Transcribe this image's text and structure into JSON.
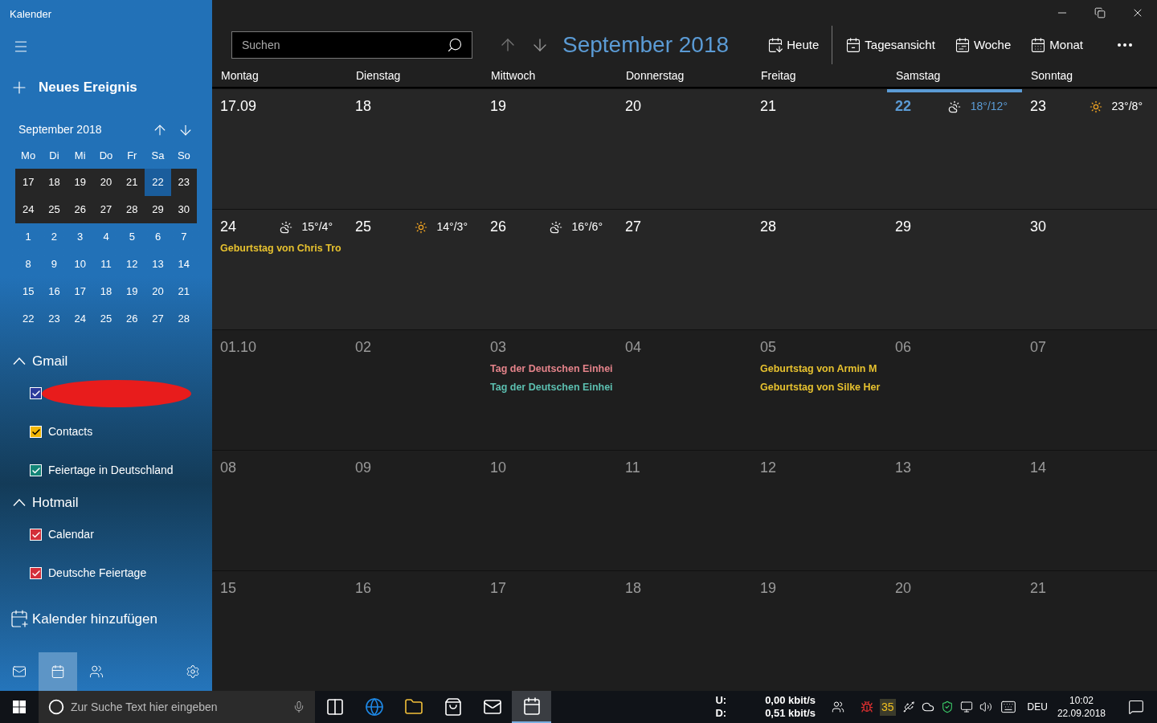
{
  "app_title": "Kalender",
  "new_event": "Neues Ereignis",
  "mini_calendar": {
    "title": "September 2018",
    "weekdays": [
      "Mo",
      "Di",
      "Mi",
      "Do",
      "Fr",
      "Sa",
      "So"
    ],
    "weeks": [
      {
        "in_view": true,
        "days": [
          {
            "label": "17",
            "selected": false
          },
          {
            "label": "18",
            "selected": false
          },
          {
            "label": "19",
            "selected": false
          },
          {
            "label": "20",
            "selected": false
          },
          {
            "label": "21",
            "selected": false
          },
          {
            "label": "22",
            "selected": true
          },
          {
            "label": "23",
            "selected": false
          }
        ]
      },
      {
        "in_view": true,
        "days": [
          {
            "label": "24",
            "selected": false
          },
          {
            "label": "25",
            "selected": false
          },
          {
            "label": "26",
            "selected": false
          },
          {
            "label": "27",
            "selected": false
          },
          {
            "label": "28",
            "selected": false
          },
          {
            "label": "29",
            "selected": false
          },
          {
            "label": "30",
            "selected": false
          }
        ]
      },
      {
        "in_view": false,
        "days": [
          {
            "label": "1",
            "selected": false
          },
          {
            "label": "2",
            "selected": false
          },
          {
            "label": "3",
            "selected": false
          },
          {
            "label": "4",
            "selected": false
          },
          {
            "label": "5",
            "selected": false
          },
          {
            "label": "6",
            "selected": false
          },
          {
            "label": "7",
            "selected": false
          }
        ]
      },
      {
        "in_view": false,
        "days": [
          {
            "label": "8",
            "selected": false
          },
          {
            "label": "9",
            "selected": false
          },
          {
            "label": "10",
            "selected": false
          },
          {
            "label": "11",
            "selected": false
          },
          {
            "label": "12",
            "selected": false
          },
          {
            "label": "13",
            "selected": false
          },
          {
            "label": "14",
            "selected": false
          }
        ]
      },
      {
        "in_view": false,
        "days": [
          {
            "label": "15",
            "selected": false
          },
          {
            "label": "16",
            "selected": false
          },
          {
            "label": "17",
            "selected": false
          },
          {
            "label": "18",
            "selected": false
          },
          {
            "label": "19",
            "selected": false
          },
          {
            "label": "20",
            "selected": false
          },
          {
            "label": "21",
            "selected": false
          }
        ]
      },
      {
        "in_view": false,
        "days": [
          {
            "label": "22",
            "selected": false
          },
          {
            "label": "23",
            "selected": false
          },
          {
            "label": "24",
            "selected": false
          },
          {
            "label": "25",
            "selected": false
          },
          {
            "label": "26",
            "selected": false
          },
          {
            "label": "27",
            "selected": false
          },
          {
            "label": "28",
            "selected": false
          }
        ]
      }
    ]
  },
  "accounts": [
    {
      "name": "Gmail",
      "expanded": true,
      "calendars": [
        {
          "redacted": true,
          "checked": true,
          "color": "#2d3b9c"
        },
        {
          "label": "Contacts",
          "checked": true,
          "color": "#f2b705"
        },
        {
          "label": "Feiertage in Deutschland",
          "checked": true,
          "color": "#138577"
        }
      ]
    },
    {
      "name": "Hotmail",
      "expanded": true,
      "calendars": [
        {
          "label": "Calendar",
          "checked": true,
          "color": "#d32f3a"
        },
        {
          "label": "Deutsche Feiertage",
          "checked": true,
          "color": "#d32f3a"
        }
      ]
    }
  ],
  "add_calendar": "Kalender hinzufügen",
  "bottom_nav": [
    {
      "kind": "mail",
      "selected": false
    },
    {
      "kind": "calendar",
      "selected": true
    },
    {
      "kind": "people",
      "selected": false
    },
    {
      "kind": "settings",
      "selected": false
    }
  ],
  "search": {
    "placeholder": "Suchen"
  },
  "month_title": "September 2018",
  "toolbar": [
    {
      "kind": "today",
      "label": "Heute"
    },
    {
      "kind": "day",
      "label": "Tagesansicht"
    },
    {
      "kind": "week",
      "label": "Woche"
    },
    {
      "kind": "month",
      "label": "Monat"
    }
  ],
  "weekdays": [
    "Montag",
    "Dienstag",
    "Mittwoch",
    "Donnerstag",
    "Freitag",
    "Samstag",
    "Sonntag"
  ],
  "weeks": [
    [
      {
        "label": "17.09",
        "current_month": true,
        "today": false
      },
      {
        "label": "18",
        "current_month": true,
        "today": false
      },
      {
        "label": "19",
        "current_month": true,
        "today": false
      },
      {
        "label": "20",
        "current_month": true,
        "today": false
      },
      {
        "label": "21",
        "current_month": true,
        "today": false
      },
      {
        "label": "22",
        "current_month": true,
        "today": true,
        "weather": {
          "kind": "partly_cloudy",
          "temp": "18°/12°"
        }
      },
      {
        "label": "23",
        "current_month": true,
        "today": false,
        "weather": {
          "kind": "sunny",
          "temp": "23°/8°"
        }
      }
    ],
    [
      {
        "label": "24",
        "current_month": true,
        "today": false,
        "weather": {
          "kind": "partly_cloudy",
          "temp": "15°/4°"
        },
        "events": [
          {
            "text": "Geburtstag von Chris Tro",
            "color": "#e6c12f"
          }
        ]
      },
      {
        "label": "25",
        "current_month": true,
        "today": false,
        "weather": {
          "kind": "sunny",
          "temp": "14°/3°"
        }
      },
      {
        "label": "26",
        "current_month": true,
        "today": false,
        "weather": {
          "kind": "partly_cloudy",
          "temp": "16°/6°"
        }
      },
      {
        "label": "27",
        "current_month": true,
        "today": false
      },
      {
        "label": "28",
        "current_month": true,
        "today": false
      },
      {
        "label": "29",
        "current_month": true,
        "today": false
      },
      {
        "label": "30",
        "current_month": true,
        "today": false
      }
    ],
    [
      {
        "label": "01.10",
        "current_month": false,
        "today": false
      },
      {
        "label": "02",
        "current_month": false,
        "today": false
      },
      {
        "label": "03",
        "current_month": false,
        "today": false,
        "events": [
          {
            "text": "Tag der Deutschen Einhei",
            "color": "#e4838a"
          },
          {
            "text": "Tag der Deutschen Einhei",
            "color": "#5cbfb0"
          }
        ]
      },
      {
        "label": "04",
        "current_month": false,
        "today": false
      },
      {
        "label": "05",
        "current_month": false,
        "today": false,
        "events": [
          {
            "text": "Geburtstag von Armin M",
            "color": "#e6c12f"
          },
          {
            "text": "Geburtstag von Silke Her",
            "color": "#e6c12f"
          }
        ]
      },
      {
        "label": "06",
        "current_month": false,
        "today": false
      },
      {
        "label": "07",
        "current_month": false,
        "today": false
      }
    ],
    [
      {
        "label": "08",
        "current_month": false,
        "today": false
      },
      {
        "label": "09",
        "current_month": false,
        "today": false
      },
      {
        "label": "10",
        "current_month": false,
        "today": false
      },
      {
        "label": "11",
        "current_month": false,
        "today": false
      },
      {
        "label": "12",
        "current_month": false,
        "today": false
      },
      {
        "label": "13",
        "current_month": false,
        "today": false
      },
      {
        "label": "14",
        "current_month": false,
        "today": false
      }
    ],
    [
      {
        "label": "15",
        "current_month": false,
        "today": false
      },
      {
        "label": "16",
        "current_month": false,
        "today": false
      },
      {
        "label": "17",
        "current_month": false,
        "today": false
      },
      {
        "label": "18",
        "current_month": false,
        "today": false
      },
      {
        "label": "19",
        "current_month": false,
        "today": false
      },
      {
        "label": "20",
        "current_month": false,
        "today": false
      },
      {
        "label": "21",
        "current_month": false,
        "today": false
      }
    ]
  ],
  "taskbar": {
    "search_placeholder": "Zur Suche Text hier eingeben",
    "apps": [
      {
        "kind": "taskview",
        "active": false
      },
      {
        "kind": "browser",
        "active": false
      },
      {
        "kind": "folder",
        "active": false
      },
      {
        "kind": "store",
        "active": false
      },
      {
        "kind": "mail",
        "active": false
      },
      {
        "kind": "calendar",
        "active": true
      }
    ],
    "network": {
      "upload_label": "U:",
      "upload": "0,00 kbit/s",
      "download_label": "D:",
      "download": "0,51 kbit/s"
    },
    "tray_badge": "35",
    "language": "DEU",
    "time": "10:02",
    "date": "22.09.2018"
  }
}
